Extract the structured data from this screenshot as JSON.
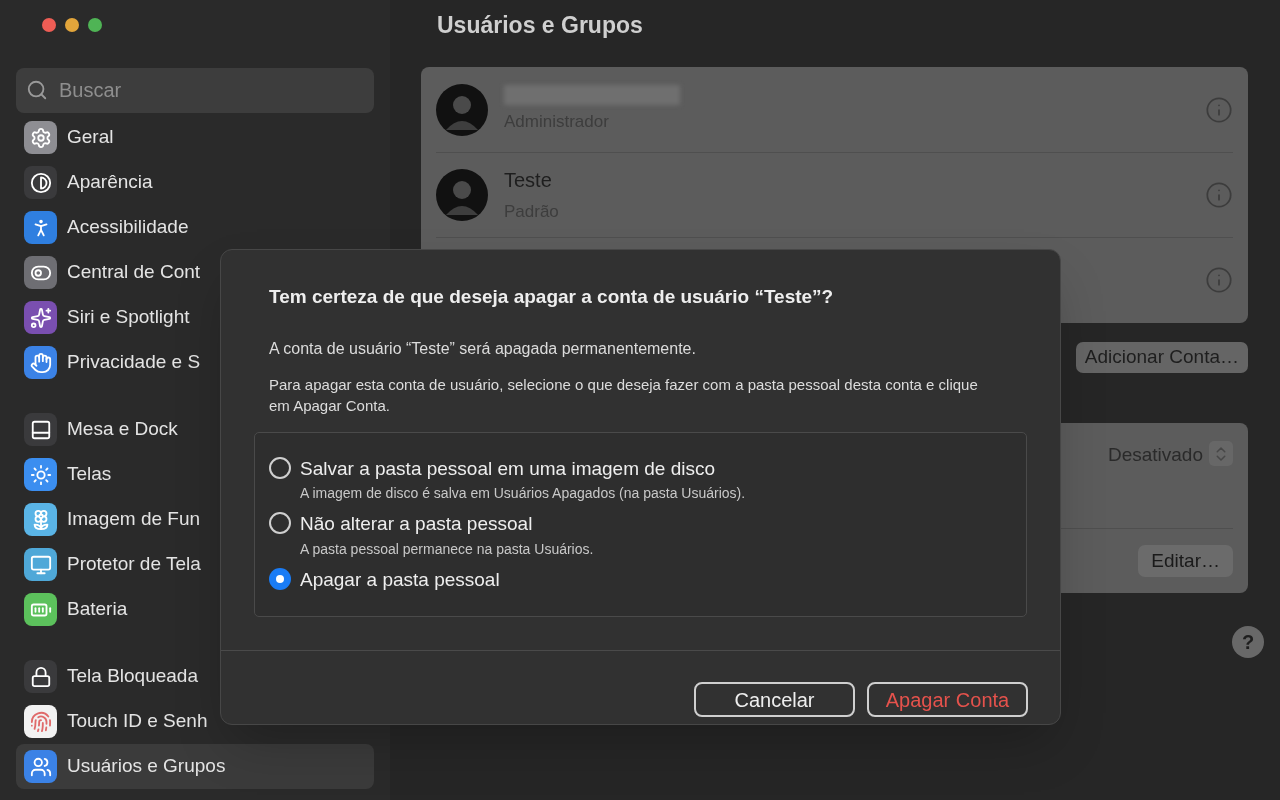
{
  "window": {
    "title": "Usuários e Grupos"
  },
  "search": {
    "placeholder": "Buscar"
  },
  "sidebar": {
    "sections": [
      {
        "items": [
          {
            "label": "Geral",
            "selected": false,
            "color": "#8e8e93"
          },
          {
            "label": "Aparência",
            "selected": false,
            "color": "#3a3a3c"
          },
          {
            "label": "Acessibilidade",
            "selected": false,
            "color": "#2f7fe0"
          },
          {
            "label": "Central de Cont",
            "selected": false,
            "color": "#6e6e73"
          },
          {
            "label": "Siri e Spotlight",
            "selected": false,
            "color": "#7a4fb0"
          },
          {
            "label": "Privacidade e S",
            "selected": false,
            "color": "#3b82e6"
          }
        ]
      },
      {
        "items": [
          {
            "label": "Mesa e Dock",
            "selected": false,
            "color": "#3a3a3c"
          },
          {
            "label": "Telas",
            "selected": false,
            "color": "#3b8ef0"
          },
          {
            "label": "Imagem de Fun",
            "selected": false,
            "color": "#5ab4e6"
          },
          {
            "label": "Protetor de Tela",
            "selected": false,
            "color": "#4fa8d8"
          },
          {
            "label": "Bateria",
            "selected": false,
            "color": "#5cc15c"
          }
        ]
      },
      {
        "items": [
          {
            "label": "Tela Bloqueada",
            "selected": false,
            "color": "#3a3a3c"
          },
          {
            "label": "Touch ID e Senh",
            "selected": false,
            "color": "#f2f2f2"
          },
          {
            "label": "Usuários e Grupos",
            "selected": true,
            "color": "#3b82e6"
          }
        ]
      }
    ]
  },
  "accounts": [
    {
      "kind": "account",
      "redacted": true,
      "role": "Administrador"
    },
    {
      "kind": "account",
      "redacted": false,
      "name": "Teste",
      "role": "Padrão"
    },
    {
      "kind": "covered"
    }
  ],
  "add_button": "Adicionar Conta…",
  "settings_card": {
    "popup": "Desativado",
    "edit_button": "Editar…"
  },
  "help_button": "?",
  "dialog": {
    "title": "Tem certeza de que deseja apagar a conta de usuário “Teste”?",
    "paragraphs": [
      "A conta de usuário “Teste” será apagada permanentemente.",
      "Para apagar esta conta de usuário, selecione o que deseja fazer com a pasta pessoal desta conta e clique em Apagar Conta."
    ],
    "options": [
      {
        "label": "Salvar a pasta pessoal em uma imagem de disco",
        "description": "A imagem de disco é salva em Usuários Apagados (na pasta Usuários).",
        "selected": false
      },
      {
        "label": "Não alterar a pasta pessoal",
        "description": "A pasta pessoal permanece na pasta Usuários.",
        "selected": false
      },
      {
        "label": "Apagar a pasta pessoal",
        "selected": true
      }
    ],
    "buttons": [
      {
        "label": "Cancelar",
        "kind": "default"
      },
      {
        "label": "Apagar Conta",
        "kind": "destructive"
      }
    ]
  }
}
